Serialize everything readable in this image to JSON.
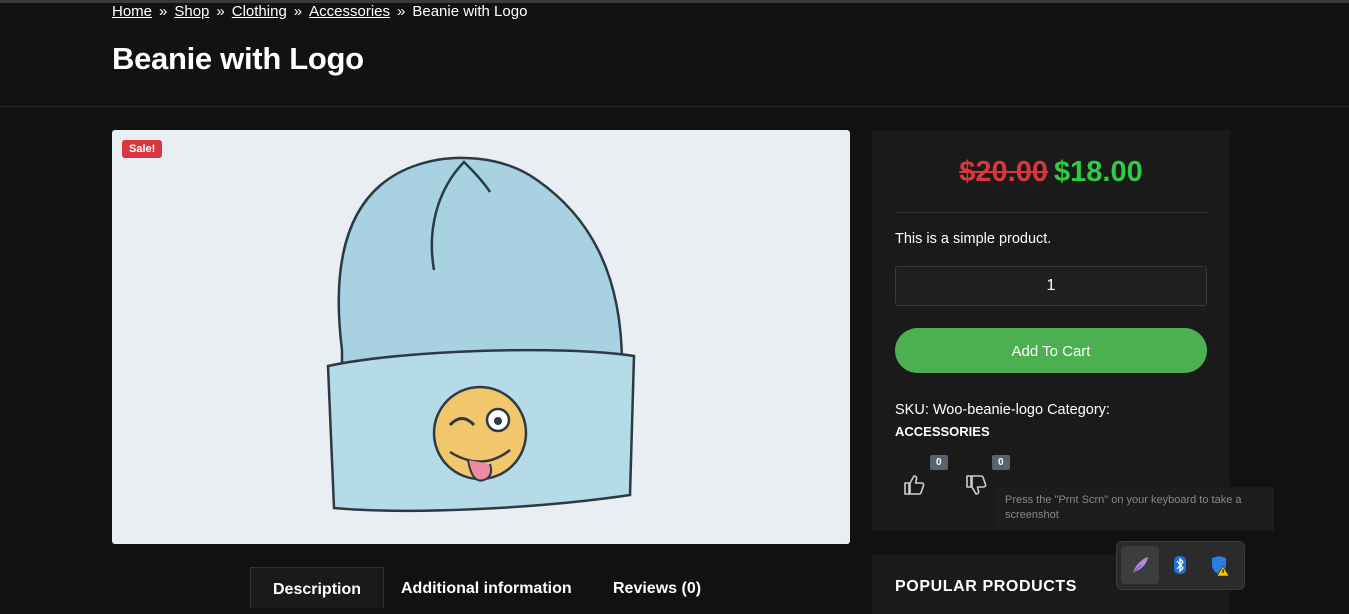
{
  "breadcrumb": {
    "home": "Home",
    "shop": "Shop",
    "clothing": "Clothing",
    "accessories": "Accessories",
    "current": "Beanie with Logo",
    "separator": "»"
  },
  "product": {
    "title": "Beanie with Logo",
    "sale_badge": "Sale!",
    "price_old": "$20.00",
    "price_new": "$18.00",
    "short_description": "This is a simple product.",
    "quantity": "1",
    "add_to_cart": "Add To Cart",
    "meta_text": "SKU: Woo-beanie-logo Category:",
    "category": "ACCESSORIES",
    "likes": "0",
    "dislikes": "0"
  },
  "tabs": [
    "Description",
    "Additional information",
    "Reviews (0)"
  ],
  "sidebar": {
    "popular_title": "POPULAR PRODUCTS"
  },
  "tooltip": {
    "text": "Press the \"Prnt Scrn\" on your keyboard to take a screenshot"
  },
  "tray": {
    "icons": [
      "pen-icon",
      "bluetooth-icon",
      "security-warning-icon"
    ]
  },
  "colors": {
    "background": "#111111",
    "sale_red": "#d9363e",
    "price_green": "#2ecc40",
    "cart_green": "#4caf50",
    "beanie_blue": "#a8d2e2"
  }
}
